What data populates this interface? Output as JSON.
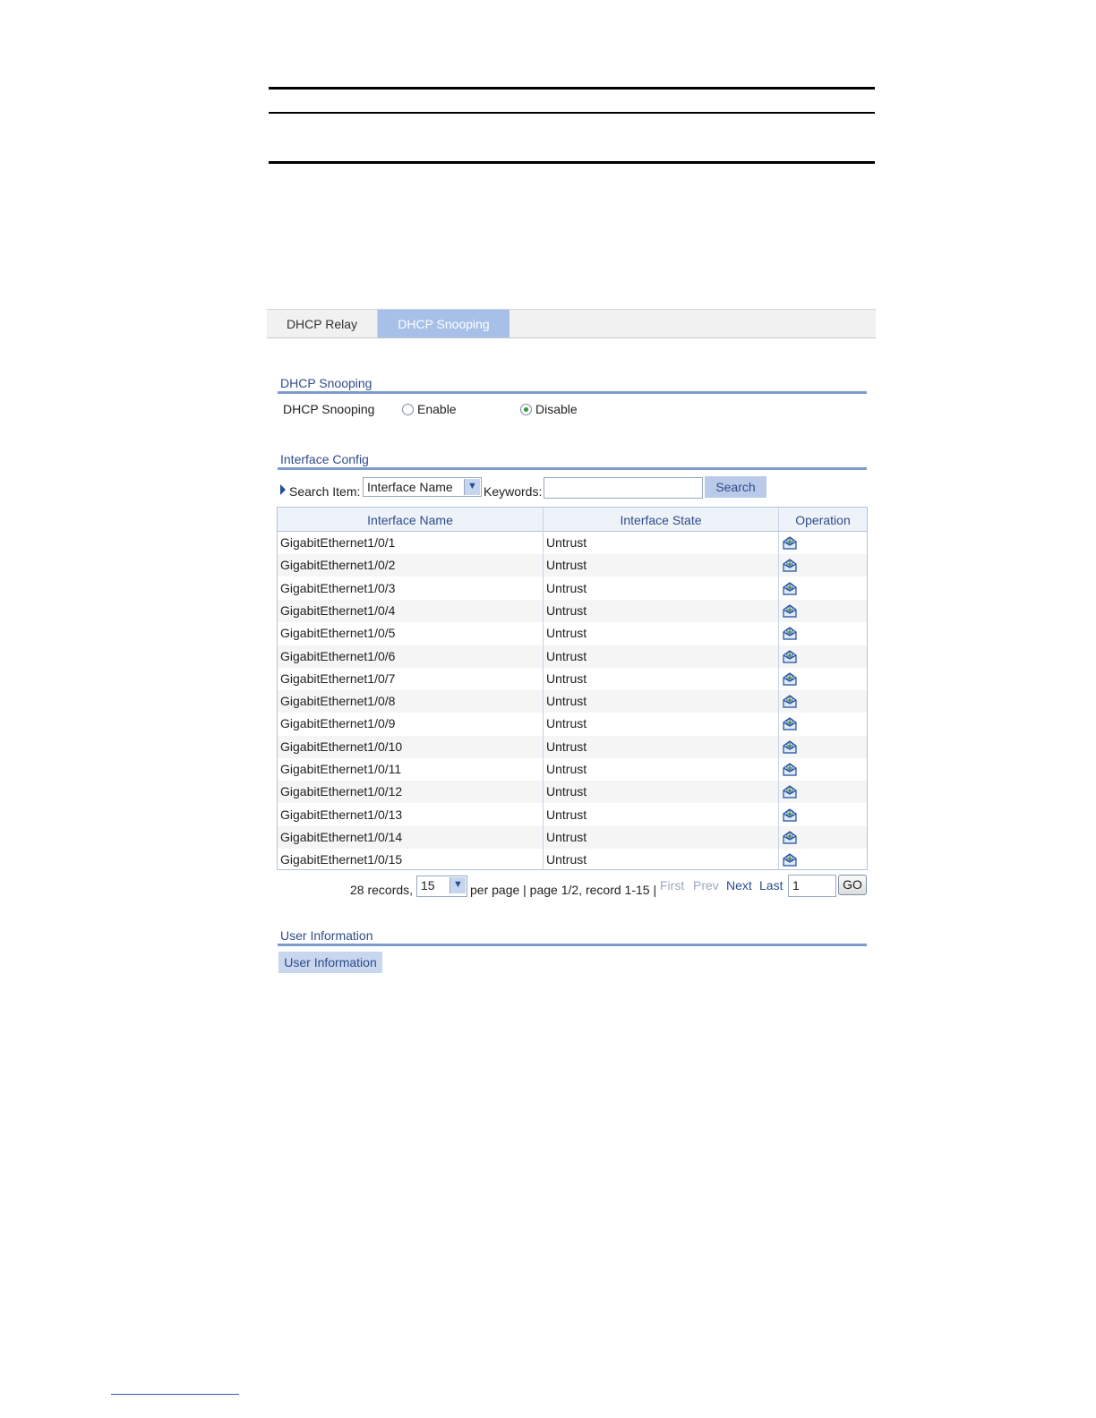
{
  "tabs": [
    {
      "label": "DHCP Relay",
      "active": false
    },
    {
      "label": "DHCP Snooping",
      "active": true
    }
  ],
  "snooping_section": {
    "title": "DHCP Snooping",
    "field_label": "DHCP Snooping",
    "options": [
      {
        "label": "Enable",
        "checked": false
      },
      {
        "label": "Disable",
        "checked": true
      }
    ]
  },
  "interface_section": {
    "title": "Interface Config",
    "search_label": "Search Item:",
    "search_item_value": "Interface Name",
    "keywords_label": "Keywords:",
    "keywords_value": "",
    "search_button": "Search",
    "columns": [
      "Interface Name",
      "Interface State",
      "Operation"
    ],
    "rows": [
      {
        "name": "GigabitEthernet1/0/1",
        "state": "Untrust"
      },
      {
        "name": "GigabitEthernet1/0/2",
        "state": "Untrust"
      },
      {
        "name": "GigabitEthernet1/0/3",
        "state": "Untrust"
      },
      {
        "name": "GigabitEthernet1/0/4",
        "state": "Untrust"
      },
      {
        "name": "GigabitEthernet1/0/5",
        "state": "Untrust"
      },
      {
        "name": "GigabitEthernet1/0/6",
        "state": "Untrust"
      },
      {
        "name": "GigabitEthernet1/0/7",
        "state": "Untrust"
      },
      {
        "name": "GigabitEthernet1/0/8",
        "state": "Untrust"
      },
      {
        "name": "GigabitEthernet1/0/9",
        "state": "Untrust"
      },
      {
        "name": "GigabitEthernet1/0/10",
        "state": "Untrust"
      },
      {
        "name": "GigabitEthernet1/0/11",
        "state": "Untrust"
      },
      {
        "name": "GigabitEthernet1/0/12",
        "state": "Untrust"
      },
      {
        "name": "GigabitEthernet1/0/13",
        "state": "Untrust"
      },
      {
        "name": "GigabitEthernet1/0/14",
        "state": "Untrust"
      },
      {
        "name": "GigabitEthernet1/0/15",
        "state": "Untrust"
      }
    ],
    "operation_icon": "edit-icon"
  },
  "pagination": {
    "records_text": "28 records,",
    "per_page_value": "15",
    "page_info_text": "per page | page 1/2, record 1-15 |",
    "first": "First",
    "prev": "Prev",
    "next": "Next",
    "last": "Last",
    "page_input_value": "1",
    "go_label": "GO"
  },
  "user_section": {
    "title": "User Information",
    "button": "User Information"
  },
  "colors": {
    "accent": "#2e4c8a",
    "active_tab": "#a6c0e7",
    "section_line": "#7e9ccb"
  }
}
